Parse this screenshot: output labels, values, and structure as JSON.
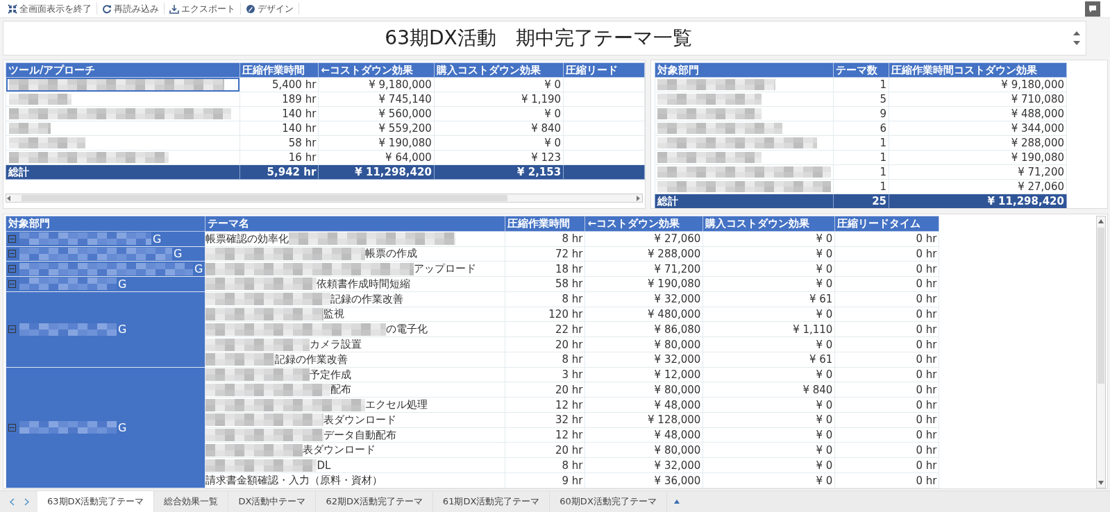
{
  "toolbar": [
    {
      "kind": "exit_fullscreen",
      "label": "全画面表示を終了"
    },
    {
      "kind": "reload",
      "label": "再読み込み"
    },
    {
      "kind": "export",
      "label": "エクスポート"
    },
    {
      "kind": "design",
      "label": "デザイン"
    }
  ],
  "title": "63期DX活動　期中完了テーマ一覧",
  "tool_table": {
    "columns": [
      "ツール/アプローチ",
      "圧縮作業時間",
      "←コストダウン効果",
      "購入コストダウン効果",
      "圧縮リード"
    ],
    "rows": [
      {
        "masked": true,
        "focused": true,
        "hours": "5,400 hr",
        "cost": "¥ 9,180,000",
        "purchase": "¥ 0"
      },
      {
        "masked": true,
        "focused": false,
        "hours": "189 hr",
        "cost": "¥ 745,140",
        "purchase": "¥ 1,190"
      },
      {
        "masked": true,
        "focused": false,
        "hours": "140 hr",
        "cost": "¥ 560,000",
        "purchase": "¥ 0"
      },
      {
        "masked": true,
        "focused": false,
        "hours": "140 hr",
        "cost": "¥ 559,200",
        "purchase": "¥ 840"
      },
      {
        "masked": true,
        "focused": false,
        "hours": "58 hr",
        "cost": "¥ 190,080",
        "purchase": "¥ 0"
      },
      {
        "masked": true,
        "focused": false,
        "hours": "16 hr",
        "cost": "¥ 64,000",
        "purchase": "¥ 123"
      }
    ],
    "total": {
      "label": "総計",
      "hours": "5,942 hr",
      "cost": "¥ 11,298,420",
      "purchase": "¥ 2,153"
    }
  },
  "dept_table": {
    "columns": [
      "対象部門",
      "テーマ数",
      "圧縮作業時間コストダウン効果"
    ],
    "rows": [
      {
        "masked": true,
        "count": "1",
        "effect": "¥ 9,180,000"
      },
      {
        "masked": true,
        "count": "5",
        "effect": "¥ 710,080"
      },
      {
        "masked": true,
        "count": "9",
        "effect": "¥ 488,000"
      },
      {
        "masked": true,
        "count": "6",
        "effect": "¥ 344,000"
      },
      {
        "masked": true,
        "count": "1",
        "effect": "¥ 288,000"
      },
      {
        "masked": true,
        "count": "1",
        "effect": "¥ 190,080"
      },
      {
        "masked": true,
        "count": "1",
        "effect": "¥ 71,200"
      },
      {
        "masked": true,
        "count": "1",
        "effect": "¥ 27,060"
      }
    ],
    "total": {
      "label": "総計",
      "count": "25",
      "effect": "¥ 11,298,420"
    }
  },
  "theme_table": {
    "columns": [
      "対象部門",
      "テーマ名",
      "圧縮作業時間",
      "←コストダウン効果",
      "購入コストダウン効果",
      "圧縮リードタイム"
    ],
    "groups": [
      {
        "suffix": "G",
        "expanded": true,
        "rows": [
          {
            "theme": "帳票確認の効率化",
            "blur_before": false,
            "blur_after": true,
            "hours": "8 hr",
            "cost": "¥ 27,060",
            "purchase": "¥ 0",
            "lead": "0 hr"
          }
        ]
      },
      {
        "suffix": "G",
        "expanded": true,
        "rows": [
          {
            "theme": "帳票の作成",
            "blur_before": true,
            "blur_after": false,
            "hours": "72 hr",
            "cost": "¥ 288,000",
            "purchase": "¥ 0",
            "lead": "0 hr"
          }
        ]
      },
      {
        "suffix": "G",
        "expanded": true,
        "rows": [
          {
            "theme": "アップロード",
            "blur_before": true,
            "blur_after": false,
            "hours": "18 hr",
            "cost": "¥ 71,200",
            "purchase": "¥ 0",
            "lead": "0 hr"
          }
        ]
      },
      {
        "suffix": "G",
        "expanded": true,
        "rows": [
          {
            "theme": "依頼書作成時間短縮",
            "blur_before": true,
            "blur_after": false,
            "hours": "58 hr",
            "cost": "¥ 190,080",
            "purchase": "¥ 0",
            "lead": "0 hr"
          }
        ]
      },
      {
        "suffix": "G",
        "expanded": true,
        "rows": [
          {
            "theme": "記録の作業改善",
            "blur_before": true,
            "blur_after": false,
            "hours": "8 hr",
            "cost": "¥ 32,000",
            "purchase": "¥ 61",
            "lead": "0 hr"
          },
          {
            "theme": "監視",
            "blur_before": true,
            "blur_after": false,
            "hours": "120 hr",
            "cost": "¥ 480,000",
            "purchase": "¥ 0",
            "lead": "0 hr"
          },
          {
            "theme": "の電子化",
            "blur_before": true,
            "blur_after": false,
            "hours": "22 hr",
            "cost": "¥ 86,080",
            "purchase": "¥ 1,110",
            "lead": "0 hr"
          },
          {
            "theme": "カメラ設置",
            "blur_before": true,
            "blur_after": false,
            "hours": "20 hr",
            "cost": "¥ 80,000",
            "purchase": "¥ 0",
            "lead": "0 hr"
          },
          {
            "theme": "記録の作業改善",
            "blur_before": true,
            "blur_after": false,
            "hours": "8 hr",
            "cost": "¥ 32,000",
            "purchase": "¥ 61",
            "lead": "0 hr"
          }
        ]
      },
      {
        "suffix": "G",
        "expanded": true,
        "rows": [
          {
            "theme": "予定作成",
            "blur_before": true,
            "blur_after": false,
            "hours": "3 hr",
            "cost": "¥ 12,000",
            "purchase": "¥ 0",
            "lead": "0 hr"
          },
          {
            "theme": "配布",
            "blur_before": true,
            "blur_after": false,
            "hours": "20 hr",
            "cost": "¥ 80,000",
            "purchase": "¥ 840",
            "lead": "0 hr"
          },
          {
            "theme": "エクセル処理",
            "blur_before": true,
            "blur_after": false,
            "hours": "12 hr",
            "cost": "¥ 48,000",
            "purchase": "¥ 0",
            "lead": "0 hr"
          },
          {
            "theme": "表ダウンロード",
            "blur_before": true,
            "blur_after": false,
            "hours": "32 hr",
            "cost": "¥ 128,000",
            "purchase": "¥ 0",
            "lead": "0 hr"
          },
          {
            "theme": "データ自動配布",
            "blur_before": true,
            "blur_after": false,
            "hours": "12 hr",
            "cost": "¥ 48,000",
            "purchase": "¥ 0",
            "lead": "0 hr"
          },
          {
            "theme": "表ダウンロード",
            "blur_before": true,
            "blur_after": false,
            "hours": "20 hr",
            "cost": "¥ 80,000",
            "purchase": "¥ 0",
            "lead": "0 hr"
          },
          {
            "theme": "DL",
            "blur_before": true,
            "blur_after": false,
            "hours": "8 hr",
            "cost": "¥ 32,000",
            "purchase": "¥ 0",
            "lead": "0 hr"
          },
          {
            "theme": "請求書金額確認・入力（原料・資材）",
            "blur_before": false,
            "blur_after": false,
            "hours": "9 hr",
            "cost": "¥ 36,000",
            "purchase": "¥ 0",
            "lead": "0 hr"
          }
        ]
      }
    ]
  },
  "sheet_tabs": [
    {
      "label": "63期DX活動完了テーマ",
      "selected": true
    },
    {
      "label": "総合効果一覧",
      "selected": false
    },
    {
      "label": "DX活動中テーマ",
      "selected": false
    },
    {
      "label": "62期DX活動完了テーマ",
      "selected": false
    },
    {
      "label": "61期DX活動完了テーマ",
      "selected": false
    },
    {
      "label": "60期DX活動完了テーマ",
      "selected": false
    }
  ]
}
